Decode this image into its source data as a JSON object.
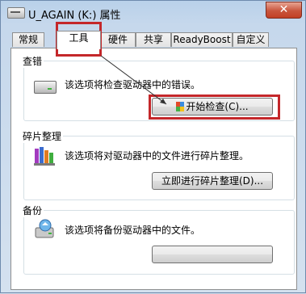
{
  "window": {
    "title": "U_AGAIN (K:) 属性",
    "close_label": "✕"
  },
  "tabs": [
    {
      "label": "常规"
    },
    {
      "label": "工具",
      "active": true
    },
    {
      "label": "硬件"
    },
    {
      "label": "共享"
    },
    {
      "label": "ReadyBoost"
    },
    {
      "label": "自定义"
    }
  ],
  "groups": {
    "check": {
      "title": "查错",
      "description": "该选项将检查驱动器中的错误。",
      "button_label": "开始检查(C)...",
      "icon": "drive-icon"
    },
    "defrag": {
      "title": "碎片整理",
      "description": "该选项将对驱动器中的文件进行碎片整理。",
      "button_label": "立即进行碎片整理(D)...",
      "icon": "defrag-icon"
    },
    "backup": {
      "title": "备份",
      "description": "该选项将备份驱动器中的文件。",
      "button_label": "",
      "icon": "backup-icon"
    }
  },
  "annotation_color": "#c4272a"
}
